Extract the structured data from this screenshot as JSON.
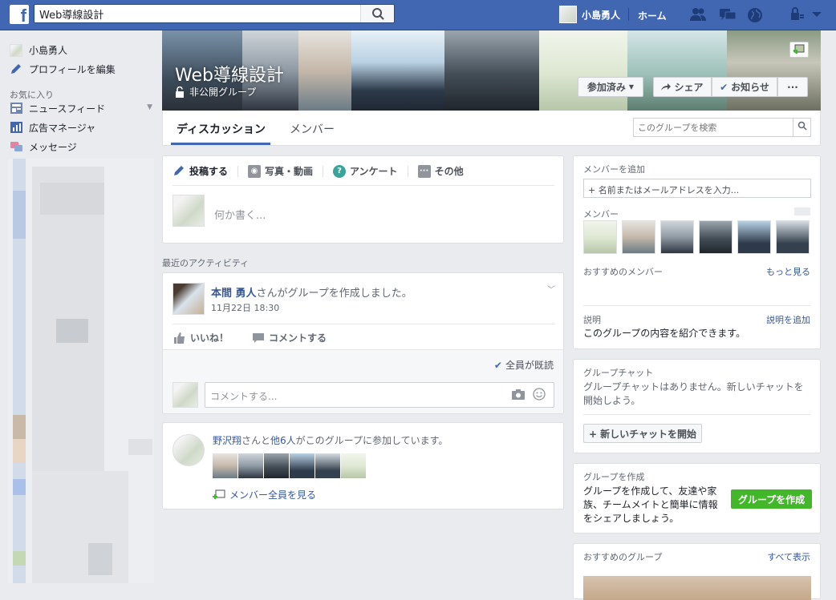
{
  "topbar": {
    "search_value": "Web導線設計",
    "user_name": "小島勇人",
    "home_label": "ホーム",
    "icons": [
      "friends-icon",
      "messages-icon",
      "notifications-globe-icon",
      "privacy-lock-icon",
      "account-menu-icon"
    ]
  },
  "leftnav": {
    "user_name": "小島勇人",
    "edit_profile": "プロフィールを編集",
    "favorites_heading": "お気に入り",
    "items": [
      {
        "label": "ニュースフィード"
      },
      {
        "label": "広告マネージャ"
      },
      {
        "label": "メッセージ"
      }
    ]
  },
  "group": {
    "title": "Web導線設計",
    "privacy": "非公開グループ",
    "joined_button": "参加済み",
    "share_button": "シェア",
    "notifications_button": "お知らせ",
    "more_button": "···",
    "tabs": [
      {
        "label": "ディスカッション"
      },
      {
        "label": "メンバー"
      }
    ],
    "search_placeholder": "このグループを検索"
  },
  "composer": {
    "tabs": [
      {
        "label": "投稿する"
      },
      {
        "label": "写真・動画"
      },
      {
        "label": "アンケート"
      },
      {
        "label": "その他"
      }
    ],
    "placeholder": "何か書く..."
  },
  "activity": {
    "section_label": "最近のアクティビティ",
    "post": {
      "author": "本間 勇人",
      "action_text": "さんがグループを作成しました。",
      "timestamp": "11月22日 18:30",
      "like_label": "いいね！",
      "comment_label": "コメントする",
      "seen_label": "全員が既読",
      "comment_placeholder": "コメントする..."
    },
    "join": {
      "name": "野沢翔",
      "middle": "さんと",
      "others": "他6人",
      "rest": "がこのグループに参加しています。",
      "see_all": "メンバー全員を見る"
    }
  },
  "sidebar": {
    "add_members": {
      "title": "メンバーを追加",
      "placeholder": "+ 名前またはメールアドレスを入力..."
    },
    "members": {
      "title": "メンバー",
      "suggested_title": "おすすめのメンバー",
      "see_more": "もっと見る",
      "description_title": "説明",
      "add_description": "説明を追加",
      "description_text": "このグループの内容を紹介できます。"
    },
    "group_chat": {
      "title": "グループチャット",
      "empty_text": "グループチャットはありません。新しいチャットを開始しよう。",
      "new_chat_button": "+ 新しいチャットを開始"
    },
    "create_group": {
      "title": "グループを作成",
      "text": "グループを作成して、友達や家族、チームメイトと簡単に情報をシェアしましょう。",
      "button": "グループを作成"
    },
    "suggested_groups": {
      "title": "おすすめのグループ",
      "see_all": "すべて表示"
    }
  },
  "colors": {
    "brand": "#4267b2",
    "link": "#365899",
    "green": "#42b72a",
    "background": "#e9ebee"
  }
}
